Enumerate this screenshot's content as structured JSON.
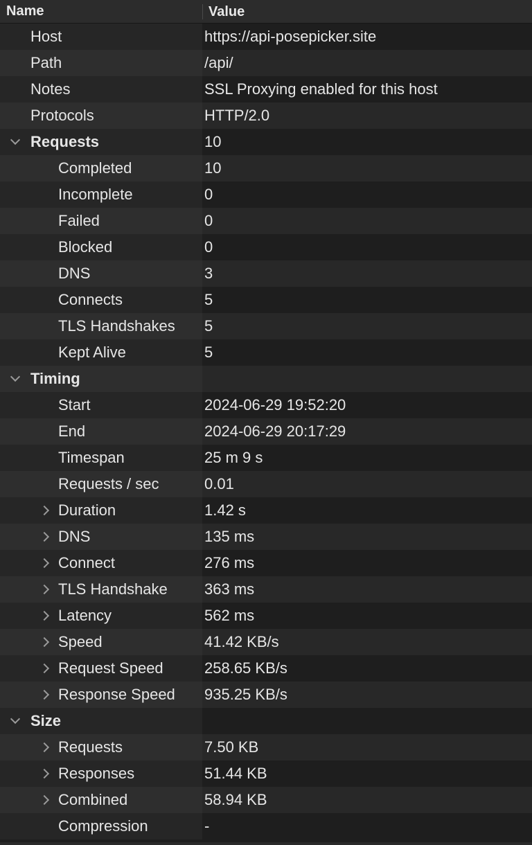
{
  "header": {
    "name": "Name",
    "value": "Value"
  },
  "rows": [
    {
      "level": 0,
      "label": "Host",
      "value": "https://api-posepicker.site"
    },
    {
      "level": 0,
      "label": "Path",
      "value": "/api/"
    },
    {
      "level": 0,
      "label": "Notes",
      "value": "SSL Proxying enabled for this host"
    },
    {
      "level": 0,
      "label": "Protocols",
      "value": "HTTP/2.0"
    },
    {
      "level": 0,
      "label": "Requests",
      "value": "10",
      "section": true,
      "toggle": "expanded"
    },
    {
      "level": 1,
      "label": "Completed",
      "value": "10"
    },
    {
      "level": 1,
      "label": "Incomplete",
      "value": "0"
    },
    {
      "level": 1,
      "label": "Failed",
      "value": "0"
    },
    {
      "level": 1,
      "label": "Blocked",
      "value": "0"
    },
    {
      "level": 1,
      "label": "DNS",
      "value": "3"
    },
    {
      "level": 1,
      "label": "Connects",
      "value": "5"
    },
    {
      "level": 1,
      "label": "TLS Handshakes",
      "value": "5"
    },
    {
      "level": 1,
      "label": "Kept Alive",
      "value": "5"
    },
    {
      "level": 0,
      "label": "Timing",
      "value": "",
      "section": true,
      "toggle": "expanded"
    },
    {
      "level": 1,
      "label": "Start",
      "value": "2024-06-29 19:52:20"
    },
    {
      "level": 1,
      "label": "End",
      "value": "2024-06-29 20:17:29"
    },
    {
      "level": 1,
      "label": "Timespan",
      "value": "25 m 9 s"
    },
    {
      "level": 1,
      "label": "Requests / sec",
      "value": "0.01"
    },
    {
      "level": 1,
      "label": "Duration",
      "value": "1.42 s",
      "toggle": "collapsed"
    },
    {
      "level": 1,
      "label": "DNS",
      "value": "135 ms",
      "toggle": "collapsed"
    },
    {
      "level": 1,
      "label": "Connect",
      "value": "276 ms",
      "toggle": "collapsed"
    },
    {
      "level": 1,
      "label": "TLS Handshake",
      "value": "363 ms",
      "toggle": "collapsed"
    },
    {
      "level": 1,
      "label": "Latency",
      "value": "562 ms",
      "toggle": "collapsed"
    },
    {
      "level": 1,
      "label": "Speed",
      "value": "41.42 KB/s",
      "toggle": "collapsed"
    },
    {
      "level": 1,
      "label": "Request Speed",
      "value": "258.65 KB/s",
      "toggle": "collapsed"
    },
    {
      "level": 1,
      "label": "Response Speed",
      "value": "935.25 KB/s",
      "toggle": "collapsed"
    },
    {
      "level": 0,
      "label": "Size",
      "value": "",
      "section": true,
      "toggle": "expanded"
    },
    {
      "level": 1,
      "label": "Requests",
      "value": "7.50 KB",
      "toggle": "collapsed"
    },
    {
      "level": 1,
      "label": "Responses",
      "value": "51.44 KB",
      "toggle": "collapsed"
    },
    {
      "level": 1,
      "label": "Combined",
      "value": "58.94 KB",
      "toggle": "collapsed"
    },
    {
      "level": 1,
      "label": "Compression",
      "value": "-"
    }
  ]
}
